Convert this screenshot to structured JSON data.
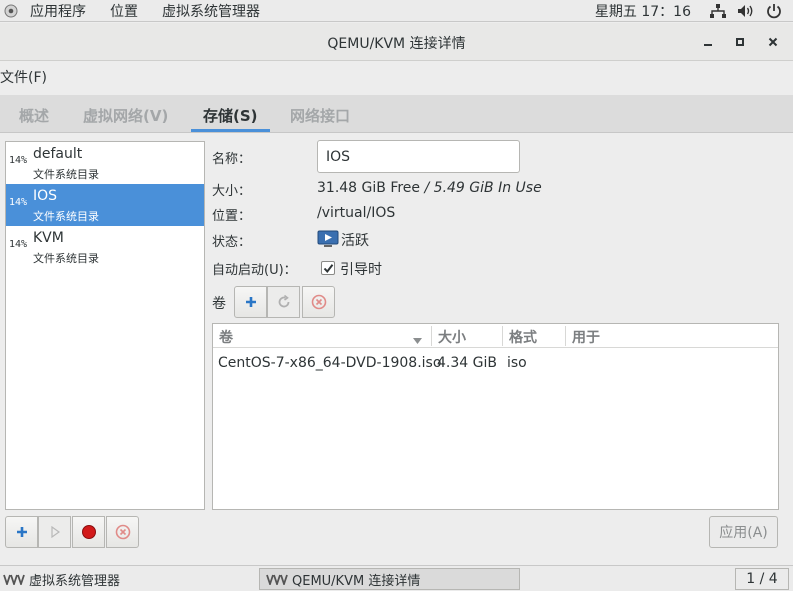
{
  "top_panel": {
    "apps_label": "应用程序",
    "places_label": "位置",
    "app_label": "虚拟系统管理器",
    "clock": "星期五 17：16"
  },
  "window": {
    "title": "QEMU/KVM 连接详情"
  },
  "menubar": {
    "file_label": "文件(F)"
  },
  "tabs": [
    {
      "label": "概述",
      "active": false
    },
    {
      "label": "虚拟网络(V)",
      "active": false
    },
    {
      "label": "存储(S)",
      "active": true
    },
    {
      "label": "网络接口",
      "active": false
    }
  ],
  "pools": [
    {
      "pct": "14%",
      "name": "default",
      "type": "文件系统目录",
      "selected": false
    },
    {
      "pct": "14%",
      "name": "IOS",
      "type": "文件系统目录",
      "selected": true
    },
    {
      "pct": "14%",
      "name": "KVM",
      "type": "文件系统目录",
      "selected": false
    }
  ],
  "detail": {
    "name_label": "名称：",
    "name_value": "IOS",
    "size_label": "大小：",
    "size_free": "31.48 GiB Free",
    "size_sep": " / ",
    "size_inuse": "5.49 GiB In Use",
    "location_label": "位置：",
    "location_value": "/virtual/IOS",
    "state_label": "状态：",
    "state_value": "活跃",
    "autostart_label": "自动启动(U)：",
    "autostart_value": "引导时",
    "autostart_checked": true,
    "volumes_label": "卷"
  },
  "volumes": {
    "headers": [
      "卷",
      "大小",
      "格式",
      "用于"
    ],
    "rows": [
      {
        "name": "CentOS-7-x86_64-DVD-1908.iso",
        "size": "4.34 GiB",
        "format": "iso",
        "used_by": ""
      }
    ]
  },
  "apply_label": "应用(A)",
  "taskbar": {
    "tasks": [
      {
        "label": "虚拟系统管理器",
        "active": false
      },
      {
        "label": "QEMU/KVM 连接详情",
        "active": true
      }
    ],
    "pager": "1 / 4"
  },
  "colors": {
    "accent": "#4a90d9",
    "record_red": "#d21a1a",
    "delete_red": "#d9534f"
  }
}
